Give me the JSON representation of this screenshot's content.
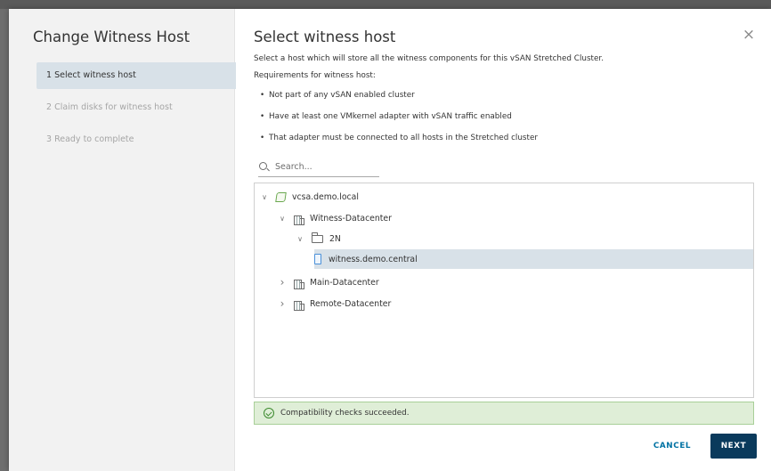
{
  "dialog": {
    "wizard_title": "Change Witness Host",
    "close_glyph": "×"
  },
  "steps": [
    {
      "label": "1 Select witness host",
      "active": true
    },
    {
      "label": "2 Claim disks for witness host",
      "active": false
    },
    {
      "label": "3 Ready to complete",
      "active": false
    }
  ],
  "main": {
    "title": "Select witness host",
    "description": "Select a host which will store all the witness components for this vSAN Stretched Cluster.",
    "requirements_label": "Requirements for witness host:",
    "bullets": [
      "Not part of any vSAN enabled cluster",
      "Have at least one VMkernel adapter with vSAN traffic enabled",
      "That adapter must be connected to all hosts in the Stretched cluster"
    ],
    "bullet_glyph": "•"
  },
  "search": {
    "placeholder": "Search...",
    "value": ""
  },
  "tree": [
    {
      "label": "vcsa.demo.local",
      "icon": "vcenter-icon",
      "expanded": true,
      "caret": "∨"
    },
    {
      "label": "Witness-Datacenter",
      "icon": "datacenter-icon",
      "expanded": true,
      "caret": "∨"
    },
    {
      "label": "2N",
      "icon": "folder-icon",
      "expanded": true,
      "caret": "∨"
    },
    {
      "label": "witness.demo.central",
      "icon": "host-icon",
      "selected": true,
      "caret": ""
    },
    {
      "label": "Main-Datacenter",
      "icon": "datacenter-icon",
      "expanded": false,
      "caret": "›"
    },
    {
      "label": "Remote-Datacenter",
      "icon": "datacenter-icon",
      "expanded": false,
      "caret": "›"
    }
  ],
  "status": {
    "message": "Compatibility checks succeeded."
  },
  "buttons": {
    "cancel": "CANCEL",
    "next": "NEXT"
  },
  "colors": {
    "accent": "#0072a3",
    "primary_button": "#0a3a5c",
    "selected_row": "#d8e1e8",
    "success_bg": "#dfeed7"
  }
}
